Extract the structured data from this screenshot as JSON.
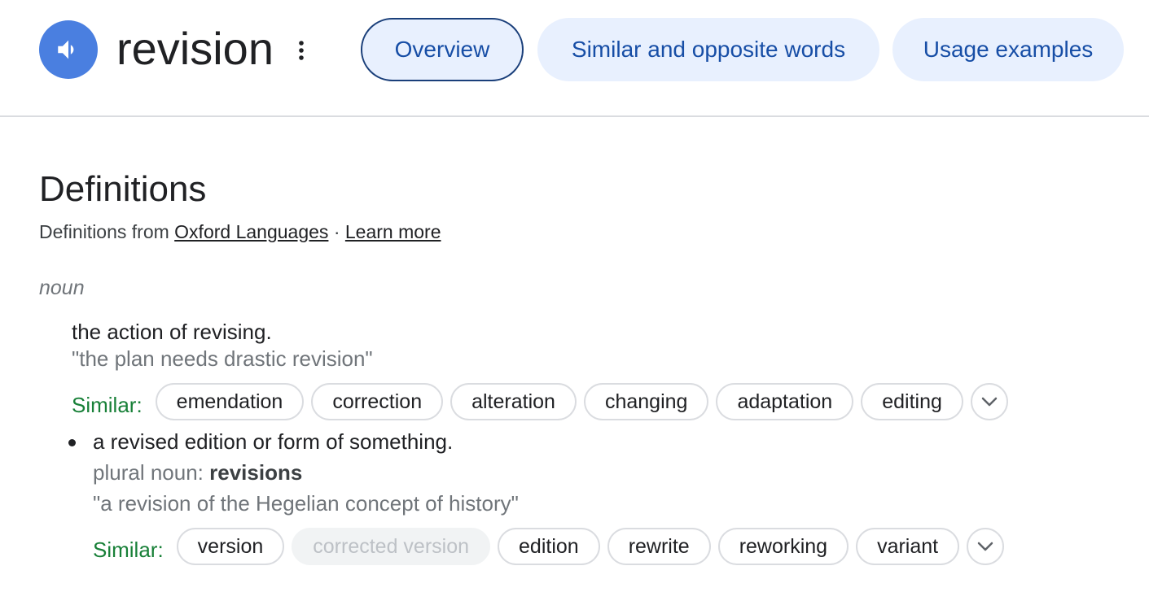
{
  "header": {
    "word": "revision",
    "tabs": [
      {
        "label": "Overview",
        "active": true
      },
      {
        "label": "Similar and opposite words",
        "active": false
      },
      {
        "label": "Usage examples",
        "active": false
      }
    ],
    "icons": {
      "speaker": "speaker-icon",
      "more": "more-vert-icon"
    },
    "accent_color": "#4a7fe0"
  },
  "definitions": {
    "title": "Definitions",
    "source_prefix": "Definitions from",
    "source_link": "Oxford Languages",
    "separator": "·",
    "learn_more": "Learn more",
    "part_of_speech": "noun",
    "senses": [
      {
        "definition": "the action of revising.",
        "example": "\"the plan needs drastic revision\"",
        "similar_label": "Similar:",
        "similar": [
          {
            "word": "emendation",
            "disabled": false
          },
          {
            "word": "correction",
            "disabled": false
          },
          {
            "word": "alteration",
            "disabled": false
          },
          {
            "word": "changing",
            "disabled": false
          },
          {
            "word": "adaptation",
            "disabled": false
          },
          {
            "word": "editing",
            "disabled": false
          }
        ]
      },
      {
        "definition": "a revised edition or form of something.",
        "plural_label": "plural noun",
        "plural_sep": ":",
        "plural_form": "revisions",
        "example": "\"a revision of the Hegelian concept of history\"",
        "similar_label": "Similar:",
        "similar": [
          {
            "word": "version",
            "disabled": false
          },
          {
            "word": "corrected version",
            "disabled": true
          },
          {
            "word": "edition",
            "disabled": false
          },
          {
            "word": "rewrite",
            "disabled": false
          },
          {
            "word": "reworking",
            "disabled": false
          },
          {
            "word": "variant",
            "disabled": false
          }
        ]
      }
    ],
    "colors": {
      "similar_label": "#188038",
      "link": "#174ea6"
    }
  }
}
